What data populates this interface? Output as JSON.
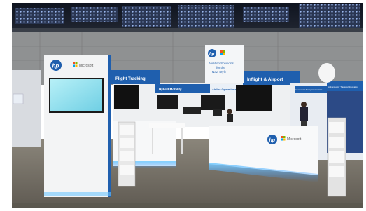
{
  "photo": {
    "subject": "Trade show exhibition booth",
    "colors": {
      "ceiling": "#1c2230",
      "ceiling_lights": "#7f9fd6",
      "hall_wall": "#8f9192",
      "floor": "#6f6a60",
      "booth_white": "#f2f3f3",
      "hp_blue": "#1f5fae",
      "led_glow": "#56b7ff",
      "screen": "#8fe0ef"
    }
  },
  "tower": {
    "brand_hp": "hp",
    "brand_microsoft": "Microsoft"
  },
  "banner_top": {
    "line1": "Aviation Solutions",
    "line2": "for the",
    "line3": "New Style",
    "brand_hp": "hp"
  },
  "header_bands": {
    "left": "Flight Tracking",
    "middle": "Hybrid Mobility",
    "center": "Airline Operations",
    "right": "Inflight & Airport"
  },
  "counter": {
    "brand_hp": "hp",
    "brand_microsoft": "Microsoft"
  },
  "right_booth": {
    "band1": "Advanced & Transport Innovation",
    "band2": "Advanced Air Transport Innovation"
  }
}
